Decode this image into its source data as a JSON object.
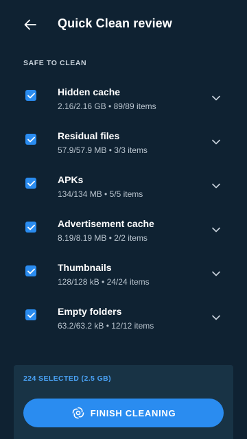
{
  "header": {
    "title": "Quick Clean review"
  },
  "section": {
    "title": "SAFE TO CLEAN"
  },
  "items": [
    {
      "label": "Hidden cache",
      "detail": "2.16/2.16 GB • 89/89 items",
      "checked": true
    },
    {
      "label": "Residual files",
      "detail": "57.9/57.9 MB • 3/3 items",
      "checked": true
    },
    {
      "label": "APKs",
      "detail": "134/134 MB • 5/5 items",
      "checked": true
    },
    {
      "label": "Advertisement cache",
      "detail": "8.19/8.19 MB • 2/2 items",
      "checked": true
    },
    {
      "label": "Thumbnails",
      "detail": "128/128 kB • 24/24 items",
      "checked": true
    },
    {
      "label": "Empty folders",
      "detail": "63.2/63.2 kB • 12/12 items",
      "checked": true
    }
  ],
  "footer": {
    "selected_text": "224 SELECTED (2.5 GB)",
    "button_label": "FINISH CLEANING"
  },
  "colors": {
    "background": "#0f2232",
    "panel": "#183345",
    "accent": "#2a8cf0",
    "accent_text": "#4aa2f5"
  },
  "icons": {
    "back": "back-arrow-icon",
    "checkbox": "checkmark-icon",
    "expand": "chevron-down-icon",
    "clean": "swirl-icon"
  }
}
